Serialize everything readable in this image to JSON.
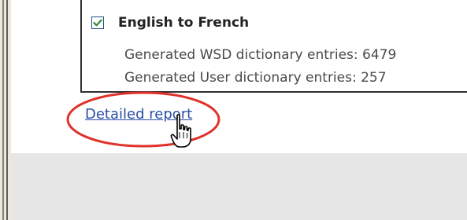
{
  "dictionary": {
    "pair_label": "English to French",
    "pair_checked": true,
    "stats": [
      {
        "label": "Generated WSD dictionary entries:",
        "value": "6479"
      },
      {
        "label": "Generated User dictionary entries:",
        "value": "257"
      }
    ]
  },
  "report_link": "Detailed report",
  "icons": {
    "checkbox_check": "check-icon",
    "cursor": "hand-pointer-icon"
  },
  "colors": {
    "link": "#2b4fa6",
    "highlight_ellipse": "#e0312b",
    "checkmark": "#2e8b2e"
  }
}
